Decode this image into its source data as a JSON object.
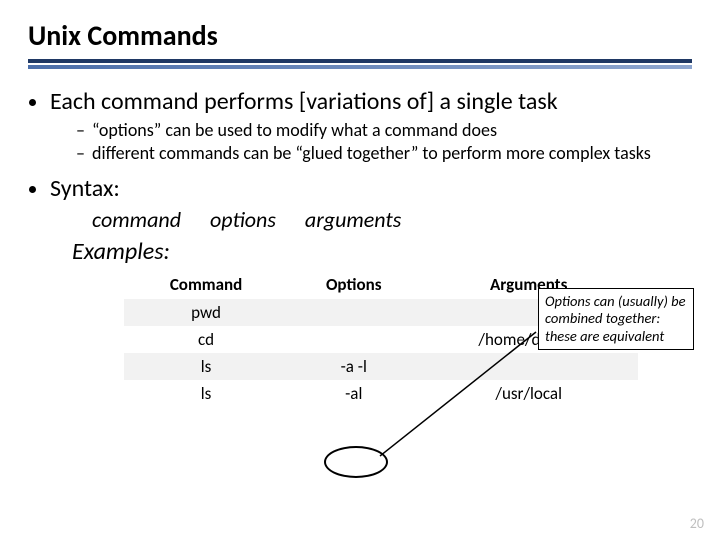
{
  "title": "Unix Commands",
  "bullets": {
    "b1": "Each command performs [variations of] a single task",
    "b1a": "“options” can be used to modify what a command does",
    "b1b": "different commands can be “glued together” to perform more complex tasks",
    "b2": "Syntax:"
  },
  "syntax": {
    "command": "command",
    "options": "options",
    "arguments": "arguments"
  },
  "examples_label": "Examples:",
  "table": {
    "headers": {
      "c0": "Command",
      "c1": "Options",
      "c2": "Arguments"
    },
    "rows": [
      {
        "c0": "pwd",
        "c1": "",
        "c2": ""
      },
      {
        "c0": "cd",
        "c1": "",
        "c2": "/home/debray"
      },
      {
        "c0": "ls",
        "c1": "-a -l",
        "c2": ""
      },
      {
        "c0": "ls",
        "c1": "-al",
        "c2": "/usr/local"
      }
    ]
  },
  "callout": "Options can (usually) be combined together: these are equivalent",
  "page_number": "20"
}
